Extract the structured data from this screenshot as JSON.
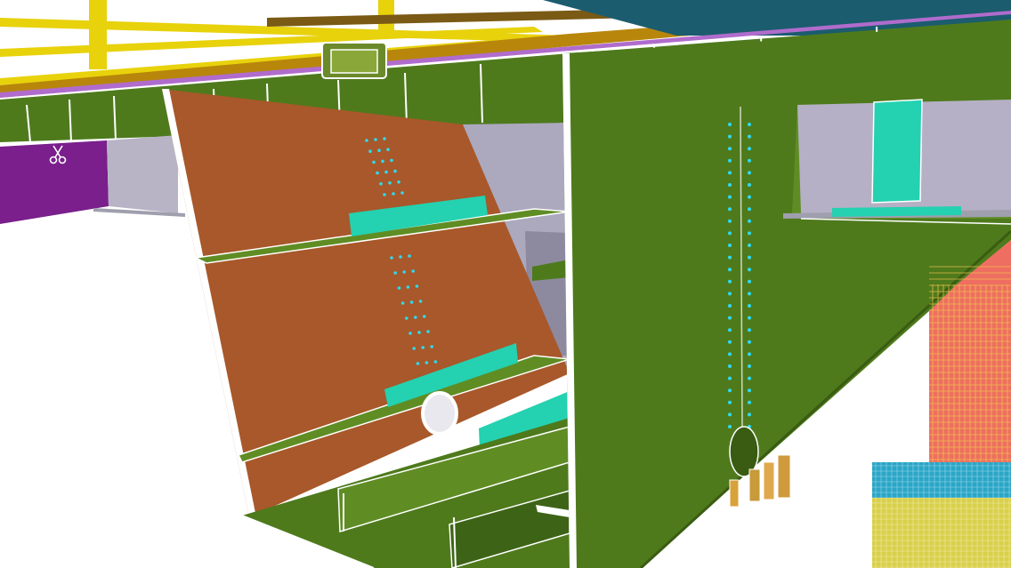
{
  "viewport": {
    "view_type": "3D model view",
    "cursor_icon": "scissors-icon"
  },
  "colors": {
    "background": "#ffffff",
    "railing": "#e8d20c",
    "deck_dark": "#b8860b",
    "walkway_top": "#7a5a14",
    "girder_green": "#4e7a1c",
    "girder_green_dark": "#3d6416",
    "girder_green_light": "#5f8d24",
    "diaphragm_brown": "#a8582a",
    "cross_plate_grey": "#aca8be",
    "pier_purple": "#7a1f8c",
    "pier_column_salmon": "#ee6e62",
    "pier_column_grid": "#f2c24d",
    "bearing_cyan": "#24d1b0",
    "bolt_cyan": "#2fd9f0",
    "edge_white": "#ffffff",
    "mesh_blue": "#2aa6c7",
    "mesh_yellow": "#d8d04a",
    "deep_blue": "#1b5c6e"
  }
}
